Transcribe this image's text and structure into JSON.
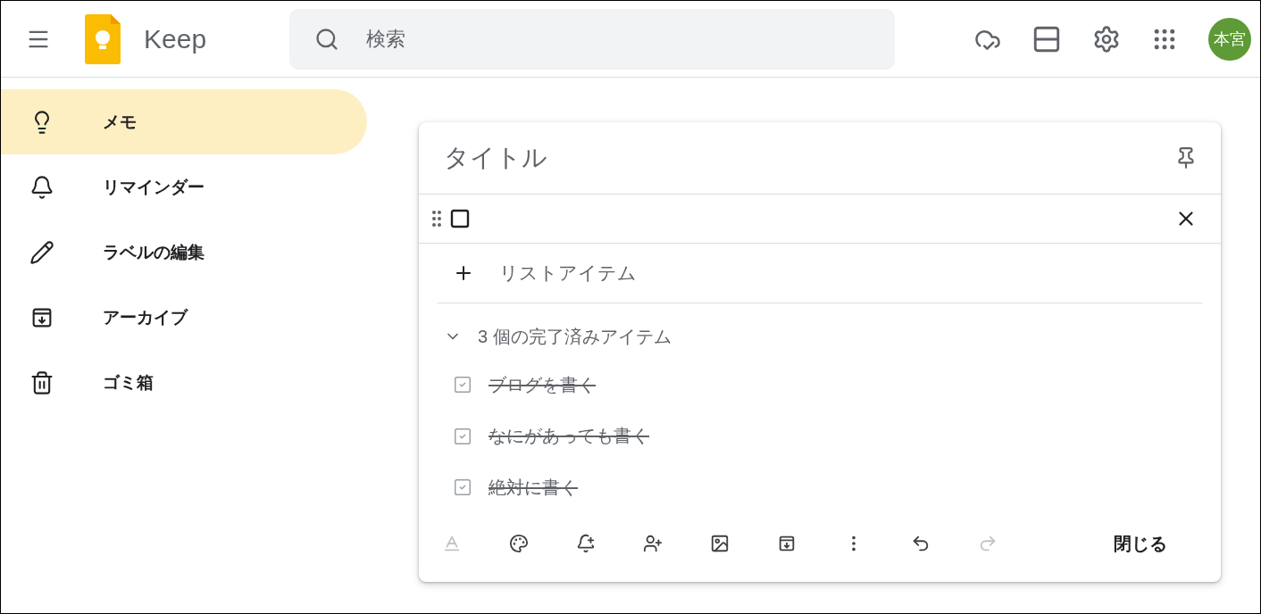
{
  "header": {
    "app_name": "Keep",
    "search": {
      "placeholder": "検索"
    },
    "avatar": {
      "initials": "本宮",
      "color": "#5e9a35"
    }
  },
  "sidebar": {
    "items": [
      {
        "kind": "notes",
        "label": "メモ",
        "selected": true
      },
      {
        "kind": "reminders",
        "label": "リマインダー",
        "selected": false
      },
      {
        "kind": "labels",
        "label": "ラベルの編集",
        "selected": false
      },
      {
        "kind": "archive",
        "label": "アーカイブ",
        "selected": false
      },
      {
        "kind": "trash",
        "label": "ゴミ箱",
        "selected": false
      }
    ]
  },
  "note": {
    "title": {
      "placeholder": "タイトル"
    },
    "new_item": {
      "checked": false
    },
    "add_item": {
      "label": "リストアイテム"
    },
    "completed": {
      "label": "3 個の完了済みアイテム",
      "expanded": true,
      "items": [
        {
          "text": "ブログを書く",
          "checked": true
        },
        {
          "text": "なにがあっても書く",
          "checked": true
        },
        {
          "text": "絶対に書く",
          "checked": true
        }
      ]
    },
    "toolbar": [
      {
        "kind": "format",
        "disabled": true
      },
      {
        "kind": "palette",
        "disabled": false
      },
      {
        "kind": "reminder",
        "disabled": false
      },
      {
        "kind": "collaborator",
        "disabled": false
      },
      {
        "kind": "image",
        "disabled": false
      },
      {
        "kind": "archive",
        "disabled": false
      },
      {
        "kind": "more",
        "disabled": false
      },
      {
        "kind": "undo",
        "disabled": false
      },
      {
        "kind": "redo",
        "disabled": true
      }
    ],
    "close_button": "閉じる"
  }
}
